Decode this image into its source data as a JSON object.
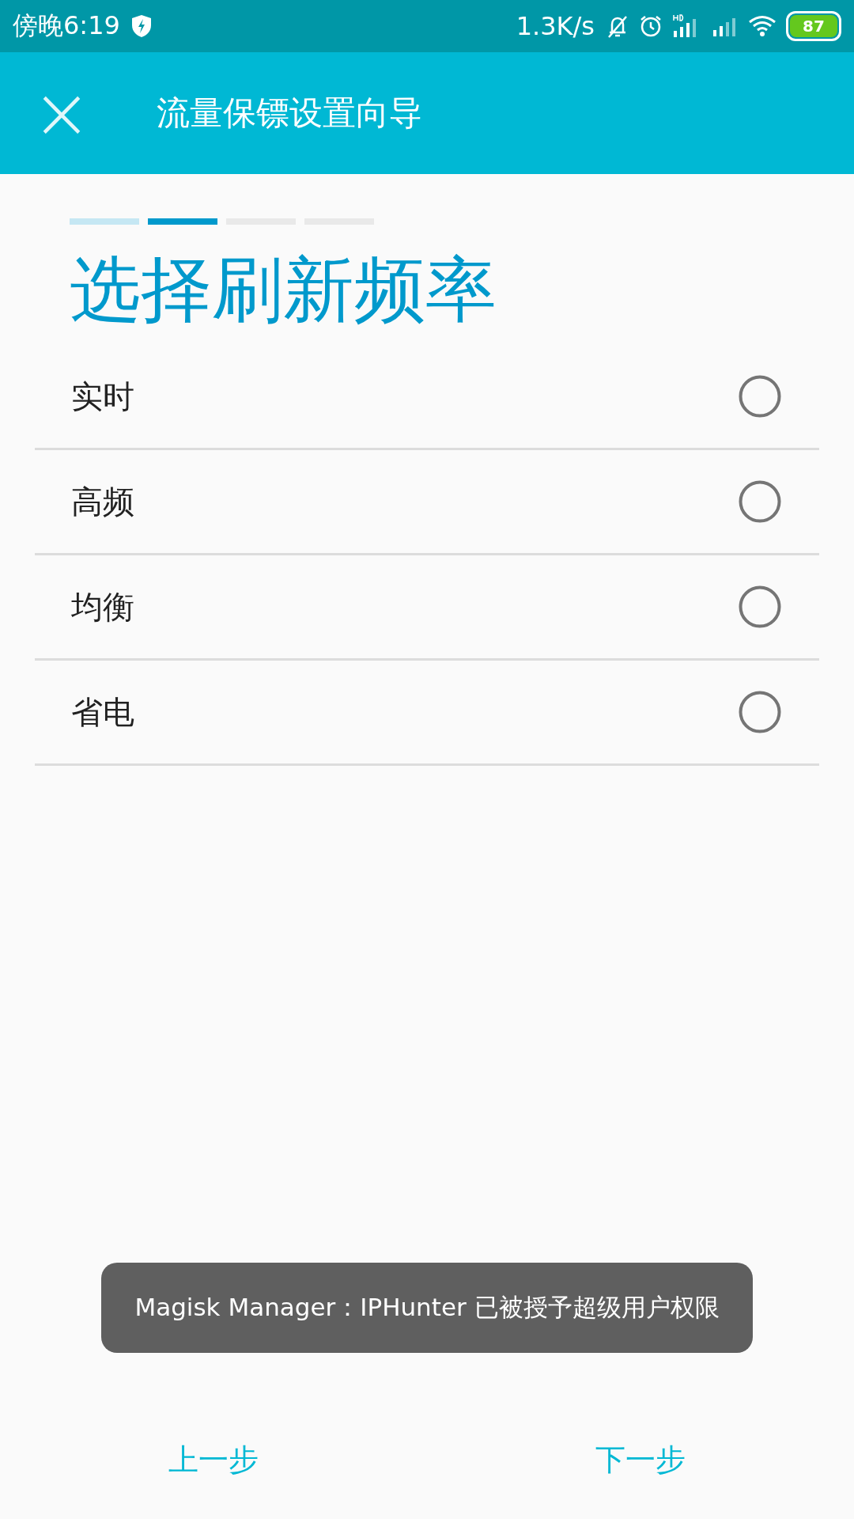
{
  "status_bar": {
    "time": "傍晚6:19",
    "net_speed": "1.3K/s",
    "battery": "87"
  },
  "app_bar": {
    "close": "×",
    "title": "流量保镖设置向导"
  },
  "steps": [
    {
      "kind": "done"
    },
    {
      "kind": "current"
    },
    {
      "kind": "upcoming"
    },
    {
      "kind": "upcoming"
    }
  ],
  "heading": "选择刷新频率",
  "options": [
    {
      "label": "实时",
      "selected": false
    },
    {
      "label": "高频",
      "selected": false
    },
    {
      "label": "均衡",
      "selected": false
    },
    {
      "label": "省电",
      "selected": false
    }
  ],
  "toast": "Magisk Manager：IPHunter 已被授予超级用户权限",
  "buttons": [
    {
      "label": "上一步"
    },
    {
      "label": "下一步"
    }
  ]
}
